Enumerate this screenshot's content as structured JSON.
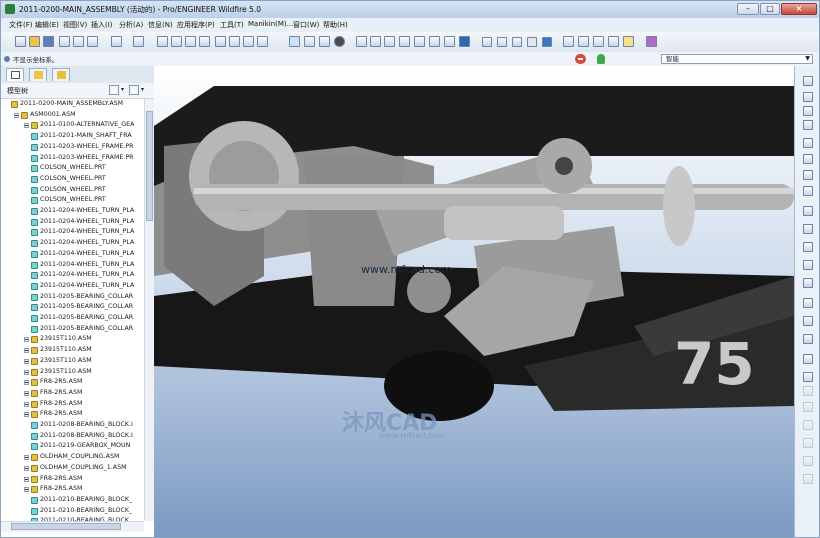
{
  "window": {
    "title": "2011-0200-MAIN_ASSEMBLY (活动的) - Pro/ENGINEER Wildfire 5.0",
    "controls": {
      "minimize": "–",
      "maximize": "□",
      "close": "×"
    }
  },
  "menu": [
    "文件(F)",
    "编辑(E)",
    "视图(V)",
    "插入(I)",
    "分析(A)",
    "信息(N)",
    "应用程序(P)",
    "工具(T)",
    "Manikin(M)...",
    "窗口(W)",
    "帮助(H)"
  ],
  "status": {
    "message": "不显示坐标系。",
    "filter_value": "智能",
    "stop_icon": "stop-icon",
    "hint_icon": "bulb-icon"
  },
  "left_panel": {
    "tab_icons": [
      "model-tree-icon",
      "folder-icon",
      "favorites-icon"
    ],
    "tree_title": "模型树",
    "tree_settings_icon": "tree-settings-icon",
    "tree_show_icon": "show-icon",
    "tree": [
      {
        "label": "2011-0200-MAIN_ASSEMBLY.ASM",
        "type": "asm",
        "level": 0,
        "expand": false
      },
      {
        "label": "ASM0001.ASM",
        "type": "asm",
        "level": 1,
        "expand": true
      },
      {
        "label": "2011-0100-ALTERNATIVE_GEA",
        "type": "asm",
        "level": 2,
        "expand": true
      },
      {
        "label": "2011-0201-MAIN_SHAFT_FRA",
        "type": "prt",
        "level": 2,
        "expand": false
      },
      {
        "label": "2011-0203-WHEEL_FRAME.PR",
        "type": "prt",
        "level": 2,
        "expand": false
      },
      {
        "label": "2011-0203-WHEEL_FRAME.PR",
        "type": "prt",
        "level": 2,
        "expand": false
      },
      {
        "label": "COLSON_WHEEL.PRT",
        "type": "prt",
        "level": 2,
        "expand": false
      },
      {
        "label": "COLSON_WHEEL.PRT",
        "type": "prt",
        "level": 2,
        "expand": false
      },
      {
        "label": "COLSON_WHEEL.PRT",
        "type": "prt",
        "level": 2,
        "expand": false
      },
      {
        "label": "COLSON_WHEEL.PRT",
        "type": "prt",
        "level": 2,
        "expand": false
      },
      {
        "label": "2011-0204-WHEEL_TURN_PLA",
        "type": "prt",
        "level": 2,
        "expand": false
      },
      {
        "label": "2011-0204-WHEEL_TURN_PLA",
        "type": "prt",
        "level": 2,
        "expand": false
      },
      {
        "label": "2011-0204-WHEEL_TURN_PLA",
        "type": "prt",
        "level": 2,
        "expand": false
      },
      {
        "label": "2011-0204-WHEEL_TURN_PLA",
        "type": "prt",
        "level": 2,
        "expand": false
      },
      {
        "label": "2011-0204-WHEEL_TURN_PLA",
        "type": "prt",
        "level": 2,
        "expand": false
      },
      {
        "label": "2011-0204-WHEEL_TURN_PLA",
        "type": "prt",
        "level": 2,
        "expand": false
      },
      {
        "label": "2011-0204-WHEEL_TURN_PLA",
        "type": "prt",
        "level": 2,
        "expand": false
      },
      {
        "label": "2011-0204-WHEEL_TURN_PLA",
        "type": "prt",
        "level": 2,
        "expand": false
      },
      {
        "label": "2011-0205-BEARING_COLLAR",
        "type": "prt",
        "level": 2,
        "expand": false
      },
      {
        "label": "2011-0205-BEARING_COLLAR",
        "type": "prt",
        "level": 2,
        "expand": false
      },
      {
        "label": "2011-0205-BEARING_COLLAR",
        "type": "prt",
        "level": 2,
        "expand": false
      },
      {
        "label": "2011-0205-BEARING_COLLAR",
        "type": "prt",
        "level": 2,
        "expand": false
      },
      {
        "label": "23915T110.ASM",
        "type": "asm",
        "level": 2,
        "expand": true
      },
      {
        "label": "23915T110.ASM",
        "type": "asm",
        "level": 2,
        "expand": true
      },
      {
        "label": "23915T110.ASM",
        "type": "asm",
        "level": 2,
        "expand": true
      },
      {
        "label": "23915T110.ASM",
        "type": "asm",
        "level": 2,
        "expand": true
      },
      {
        "label": "FR8-2RS.ASM",
        "type": "asm",
        "level": 2,
        "expand": true
      },
      {
        "label": "FR8-2RS.ASM",
        "type": "asm",
        "level": 2,
        "expand": true
      },
      {
        "label": "FR8-2RS.ASM",
        "type": "asm",
        "level": 2,
        "expand": true
      },
      {
        "label": "FR8-2RS.ASM",
        "type": "asm",
        "level": 2,
        "expand": true
      },
      {
        "label": "2011-0208-BEARING_BLOCK.I",
        "type": "prt",
        "level": 2,
        "expand": false
      },
      {
        "label": "2011-0208-BEARING_BLOCK.I",
        "type": "prt",
        "level": 2,
        "expand": false
      },
      {
        "label": "2011-0219-GEARBOX_MOUN",
        "type": "prt",
        "level": 2,
        "expand": false
      },
      {
        "label": "OLDHAM_COUPLING.ASM",
        "type": "asm",
        "level": 2,
        "expand": true
      },
      {
        "label": "OLDHAM_COUPLING_1.ASM",
        "type": "asm",
        "level": 2,
        "expand": true
      },
      {
        "label": "FR8-2RS.ASM",
        "type": "asm",
        "level": 2,
        "expand": true
      },
      {
        "label": "FR8-2RS.ASM",
        "type": "asm",
        "level": 2,
        "expand": true
      },
      {
        "label": "2011-0210-BEARING_BLOCK_",
        "type": "prt",
        "level": 2,
        "expand": false
      },
      {
        "label": "2011-0210-BEARING_BLOCK_",
        "type": "prt",
        "level": 2,
        "expand": false
      },
      {
        "label": "2011-0210-BEARING_BLOCK",
        "type": "prt",
        "level": 2,
        "expand": false
      }
    ]
  },
  "viewport": {
    "label_75": "75",
    "watermark_url": "www.mfcad.com",
    "watermark_logo": "沐风CAD",
    "watermark_logo_url": "www.mfcad.com"
  },
  "right_toolbar_icons": [
    "datum-point-icon",
    "sketch-icon",
    "line-icon",
    "curve-icon",
    "axis-icon",
    "csys-icon",
    "annotation-icon",
    "layer-icon",
    "extrude-icon",
    "revolve-icon",
    "hole-icon",
    "round-icon",
    "chamfer-icon",
    "shell-icon",
    "rib-icon",
    "draft-icon",
    "pattern-icon",
    "mirror-icon",
    "trim-icon",
    "merge-icon",
    "intersect-icon",
    "offset-icon",
    "thicken-icon",
    "solidify-icon"
  ],
  "colors": {
    "background_top": "#ffffff",
    "background_bottom": "#7b99c2",
    "part_gray": "#9a9a9a",
    "part_dark": "#1d1d1d",
    "asm_icon": "#e0c346",
    "prt_icon": "#7fd0d2"
  }
}
